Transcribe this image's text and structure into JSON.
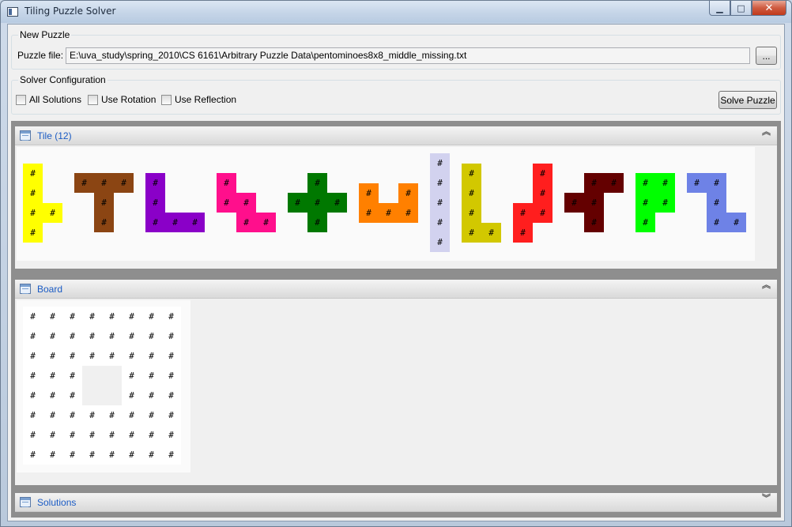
{
  "window": {
    "title": "Tiling Puzzle Solver",
    "caption_buttons": [
      "minimize-icon",
      "maximize-icon",
      "close-icon"
    ]
  },
  "new_puzzle": {
    "legend": "New Puzzle",
    "file_label": "Puzzle file:",
    "file_value": "E:\\uva_study\\spring_2010\\CS 6161\\Arbitrary Puzzle Data\\pentominoes8x8_middle_missing.txt",
    "browse_label": "..."
  },
  "solver_config": {
    "legend": "Solver Configuration",
    "all_solutions": {
      "label": "All Solutions",
      "checked": false
    },
    "use_rotation": {
      "label": "Use Rotation",
      "checked": false
    },
    "use_reflection": {
      "label": "Use Reflection",
      "checked": false
    },
    "solve_label": "Solve Puzzle"
  },
  "tile_section": {
    "title": "Tile (12)",
    "chevron": "︽",
    "cell_glyph": "#",
    "tiles": [
      {
        "color": "#ffff00",
        "cells": [
          [
            0,
            0
          ],
          [
            1,
            0
          ],
          [
            2,
            0
          ],
          [
            2,
            1
          ],
          [
            3,
            0
          ]
        ]
      },
      {
        "color": "#8b4513",
        "cells": [
          [
            0,
            0
          ],
          [
            0,
            1
          ],
          [
            0,
            2
          ],
          [
            1,
            1
          ],
          [
            2,
            1
          ]
        ]
      },
      {
        "color": "#8a00c8",
        "cells": [
          [
            0,
            0
          ],
          [
            1,
            0
          ],
          [
            2,
            0
          ],
          [
            2,
            1
          ],
          [
            2,
            2
          ]
        ]
      },
      {
        "color": "#ff0f8c",
        "cells": [
          [
            0,
            0
          ],
          [
            1,
            0
          ],
          [
            1,
            1
          ],
          [
            2,
            1
          ],
          [
            2,
            2
          ]
        ]
      },
      {
        "color": "#007800",
        "cells": [
          [
            0,
            1
          ],
          [
            1,
            0
          ],
          [
            1,
            1
          ],
          [
            1,
            2
          ],
          [
            2,
            1
          ]
        ]
      },
      {
        "color": "#ff8000",
        "cells": [
          [
            0,
            0
          ],
          [
            0,
            2
          ],
          [
            1,
            0
          ],
          [
            1,
            1
          ],
          [
            1,
            2
          ]
        ]
      },
      {
        "color": "#d2d2ef",
        "cells": [
          [
            0,
            0
          ],
          [
            1,
            0
          ],
          [
            2,
            0
          ],
          [
            3,
            0
          ],
          [
            4,
            0
          ]
        ]
      },
      {
        "color": "#d2c800",
        "cells": [
          [
            0,
            0
          ],
          [
            1,
            0
          ],
          [
            2,
            0
          ],
          [
            3,
            0
          ],
          [
            3,
            1
          ]
        ]
      },
      {
        "color": "#ff1e1e",
        "cells": [
          [
            0,
            1
          ],
          [
            1,
            1
          ],
          [
            2,
            0
          ],
          [
            2,
            1
          ],
          [
            3,
            0
          ]
        ]
      },
      {
        "color": "#640000",
        "cells": [
          [
            0,
            1
          ],
          [
            0,
            2
          ],
          [
            1,
            0
          ],
          [
            1,
            1
          ],
          [
            2,
            1
          ]
        ]
      },
      {
        "color": "#00ff00",
        "cells": [
          [
            0,
            0
          ],
          [
            0,
            1
          ],
          [
            1,
            0
          ],
          [
            1,
            1
          ],
          [
            2,
            0
          ]
        ]
      },
      {
        "color": "#6e82e6",
        "cells": [
          [
            0,
            0
          ],
          [
            0,
            1
          ],
          [
            1,
            1
          ],
          [
            2,
            1
          ],
          [
            2,
            2
          ]
        ]
      }
    ]
  },
  "board_section": {
    "title": "Board",
    "chevron": "︽",
    "rows": 8,
    "cols": 8,
    "missing_cells": [
      [
        3,
        3
      ],
      [
        3,
        4
      ],
      [
        4,
        3
      ],
      [
        4,
        4
      ]
    ],
    "cell_glyph": "#"
  },
  "solutions_section": {
    "title": "Solutions",
    "chevron": "︾"
  }
}
